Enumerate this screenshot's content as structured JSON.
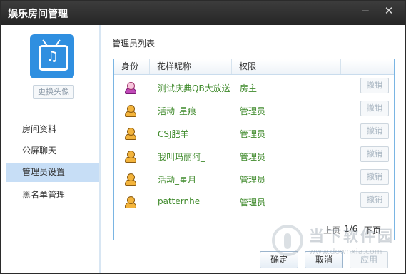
{
  "window": {
    "title": "娱乐房间管理",
    "minimize_glyph": "−",
    "close_glyph": "✕"
  },
  "sidebar": {
    "avatar_icon": "music-tv-icon",
    "change_avatar_label": "更换头像",
    "items": [
      {
        "label": "房间资料",
        "active": false
      },
      {
        "label": "公屏聊天",
        "active": false
      },
      {
        "label": "管理员设置",
        "active": true
      },
      {
        "label": "黑名单管理",
        "active": false
      }
    ]
  },
  "admin_list": {
    "title": "管理员列表",
    "columns": [
      "身份",
      "花样昵称",
      "权限"
    ],
    "rows": [
      {
        "icon": "owner-user-icon",
        "nickname": "测试庆典QB大放送",
        "role": "房主",
        "revoke_label": "撤销"
      },
      {
        "icon": "admin-user-icon",
        "nickname": "活动_星痕",
        "role": "管理员",
        "revoke_label": "撤销"
      },
      {
        "icon": "admin-user-icon",
        "nickname": "CSJ肥羊",
        "role": "管理员",
        "revoke_label": "撤销"
      },
      {
        "icon": "admin-user-icon",
        "nickname": "我叫玛丽阿_",
        "role": "管理员",
        "revoke_label": "撤销"
      },
      {
        "icon": "admin-user-icon",
        "nickname": "活动_星月",
        "role": "管理员",
        "revoke_label": "撤销"
      },
      {
        "icon": "admin-user-icon",
        "nickname": "patternhe",
        "role": "管理员",
        "revoke_label": "撤销"
      }
    ]
  },
  "pagination": {
    "prev_label": "上页",
    "page_indicator": "1/6",
    "next_label": "下页"
  },
  "buttons": {
    "ok_label": "确定",
    "cancel_label": "取消",
    "apply_label": "应用"
  },
  "watermark": {
    "brand": "当下软件园",
    "url": "www.downxia.com"
  },
  "colors": {
    "titlebar": "#2f2f2f",
    "selected_nav": "#c7def6",
    "list_border": "#7ab5e3",
    "nickname_text": "#3f8a2b"
  }
}
